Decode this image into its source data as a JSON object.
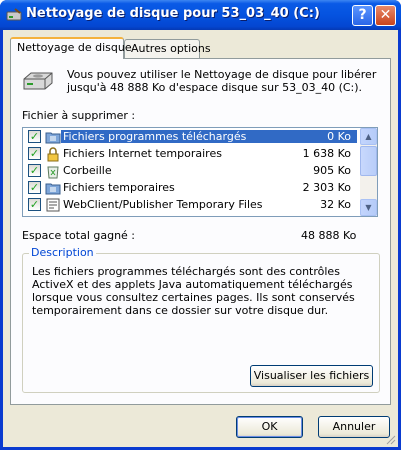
{
  "window": {
    "title": "Nettoyage de disque pour 53_03_40 (C:)",
    "help_label": "?",
    "close_label": "✕"
  },
  "tabs": [
    {
      "label": "Nettoyage de disque",
      "active": true
    },
    {
      "label": "Autres options",
      "active": false
    }
  ],
  "intro_text": "Vous pouvez utiliser le Nettoyage de disque pour libérer jusqu'à 48 888 Ko d'espace disque sur 53_03_40 (C:).",
  "files_label": "Fichier à supprimer :",
  "files": [
    {
      "name": "Fichiers programmes téléchargés",
      "size": "0 Ko",
      "checked": true,
      "selected": true,
      "icon": "folder-icon"
    },
    {
      "name": "Fichiers Internet temporaires",
      "size": "1 638 Ko",
      "checked": true,
      "selected": false,
      "icon": "lock-icon"
    },
    {
      "name": "Corbeille",
      "size": "905 Ko",
      "checked": true,
      "selected": false,
      "icon": "recycle-bin-icon"
    },
    {
      "name": "Fichiers temporaires",
      "size": "2 303 Ko",
      "checked": true,
      "selected": false,
      "icon": "folder-icon"
    },
    {
      "name": "WebClient/Publisher Temporary Files",
      "size": "32 Ko",
      "checked": true,
      "selected": false,
      "icon": "webclient-icon"
    }
  ],
  "total_label": "Espace total gagné :",
  "total_value": "48 888 Ko",
  "description": {
    "title": "Description",
    "text": "Les fichiers programmes téléchargés sont des contrôles ActiveX et des applets Java automatiquement téléchargés lorsque vous consultez certaines pages. Ils sont conservés temporairement dans ce dossier sur votre disque dur."
  },
  "buttons": {
    "view_files": "Visualiser les fichiers",
    "ok": "OK",
    "cancel": "Annuler"
  },
  "colors": {
    "titlebar": "#0553e0",
    "selection": "#316ac5",
    "group_title": "#0046d5",
    "dialog_bg": "#ece9d8"
  }
}
